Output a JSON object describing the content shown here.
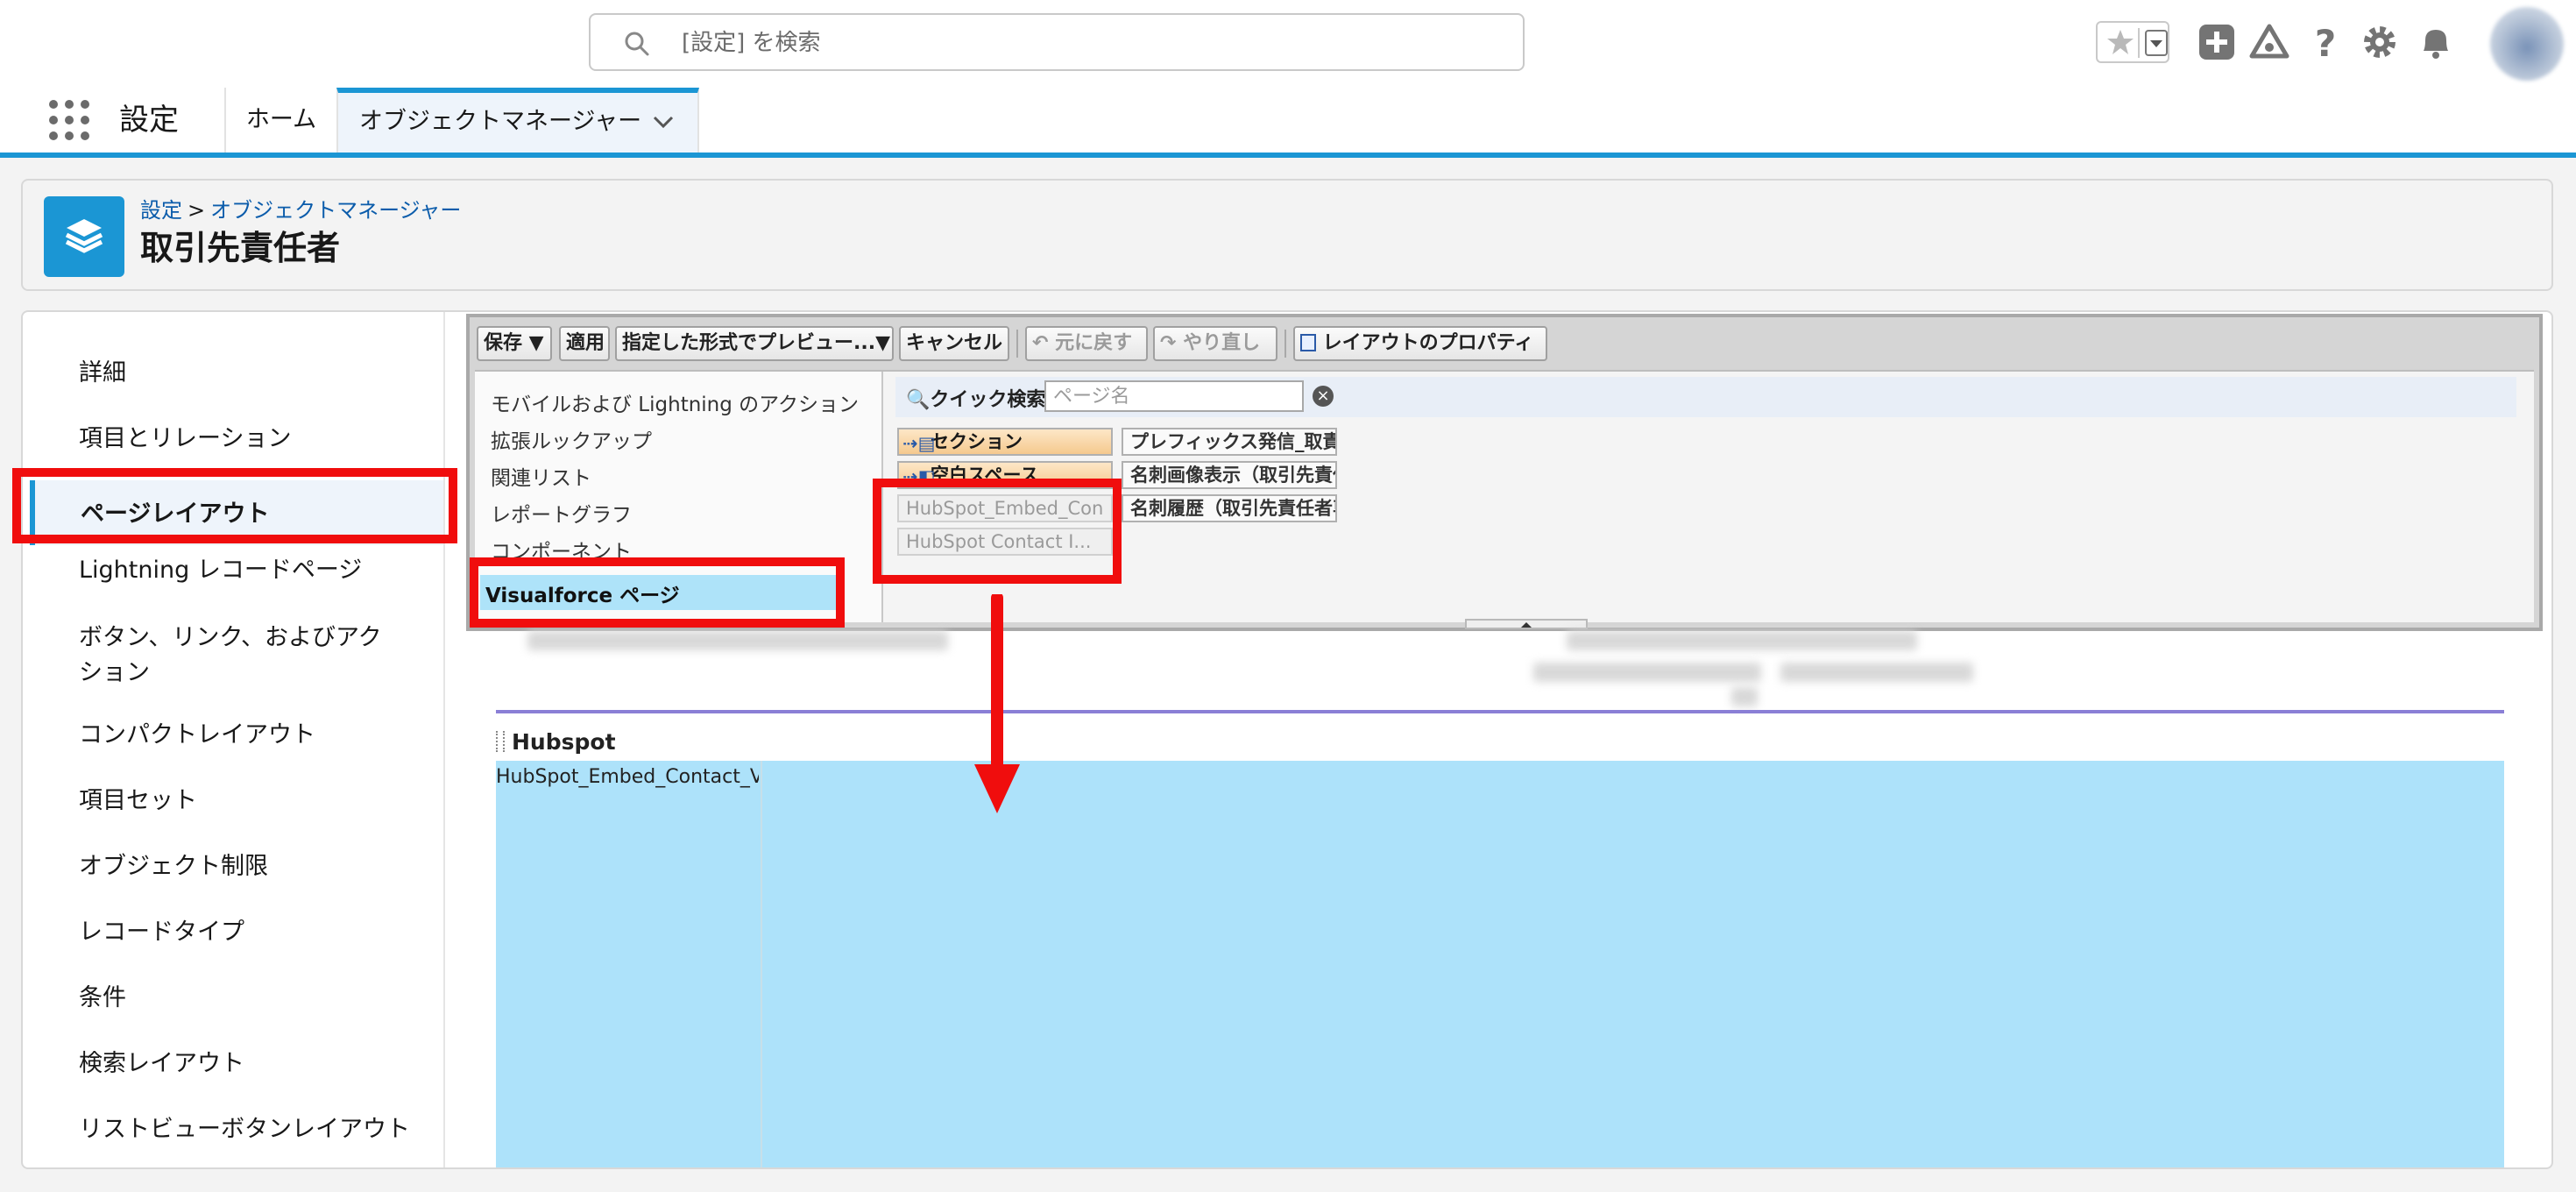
{
  "header": {
    "search_placeholder": "[設定] を検索",
    "icons": [
      "star-icon",
      "dropdown-icon",
      "add-icon",
      "trailhead-icon",
      "help-icon",
      "gear-icon",
      "bell-icon",
      "avatar"
    ]
  },
  "nav": {
    "app_name": "設定",
    "tabs": [
      {
        "label": "ホーム"
      },
      {
        "label": "オブジェクトマネージャー",
        "active": true
      }
    ]
  },
  "page": {
    "breadcrumb": [
      "設定",
      "オブジェクトマネージャー"
    ],
    "breadcrumb_sep": ">",
    "title": "取引先責任者"
  },
  "sidebar": {
    "items": [
      {
        "label": "詳細"
      },
      {
        "label": "項目とリレーション"
      },
      {
        "label": "ページレイアウト",
        "active": true
      },
      {
        "label": "Lightning レコードページ"
      },
      {
        "label": "ボタン、リンク、およびアクション"
      },
      {
        "label": "コンパクトレイアウト"
      },
      {
        "label": "項目セット"
      },
      {
        "label": "オブジェクト制限"
      },
      {
        "label": "レコードタイプ"
      },
      {
        "label": "条件"
      },
      {
        "label": "検索レイアウト"
      },
      {
        "label": "リストビューボタンレイアウト"
      }
    ]
  },
  "toolbar": {
    "save": "保存 ▼",
    "apply": "適用",
    "preview": "指定した形式でプレビュー...▼",
    "cancel": "キャンセル",
    "undo": "元に戻す",
    "redo": "やり直し",
    "layout_props": "レイアウトのプロパティ"
  },
  "palette": {
    "categories": [
      {
        "label": "モバイルおよび Lightning のアクション"
      },
      {
        "label": "拡張ルックアップ"
      },
      {
        "label": "関連リスト"
      },
      {
        "label": "レポートグラフ"
      },
      {
        "label": "コンポーネント"
      },
      {
        "label": "Visualforce ページ",
        "selected": true
      }
    ],
    "quick_search_label": "クイック検索",
    "quick_search_placeholder": "ページ名",
    "clear_symbol": "×",
    "items": [
      {
        "label": "セクション",
        "style": "orange"
      },
      {
        "label": "プレフィックス発信_取責",
        "style": "gray"
      },
      {
        "label": "空白スペース",
        "style": "orange"
      },
      {
        "label": "名刺画像表示（取引先責任",
        "style": "gray"
      },
      {
        "label": "HubSpot_Embed_Con",
        "style": "used"
      },
      {
        "label": "名刺履歴（取引先責任者専",
        "style": "gray"
      },
      {
        "label": "HubSpot Contact I...",
        "style": "used"
      }
    ]
  },
  "canvas": {
    "section_title": "Hubspot",
    "vf_page_label": "HubSpot_Embed_Contact_V"
  },
  "colors": {
    "brand_blue": "#1b96d4",
    "annotation_red": "#f00d0d",
    "section_fill": "#ade2fa"
  }
}
